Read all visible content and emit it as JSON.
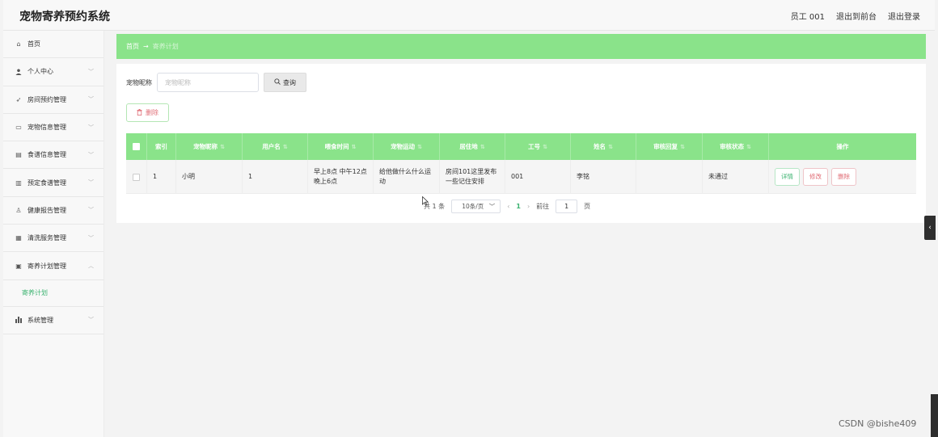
{
  "app": {
    "title": "宠物寄养预约系统"
  },
  "header": {
    "user": "员工 001",
    "to_front": "退出到前台",
    "logout": "退出登录"
  },
  "sidebar": {
    "items": [
      {
        "label": "首页",
        "icon": "home-icon",
        "glyph": "⌂",
        "has_children": false
      },
      {
        "label": "个人中心",
        "icon": "user-icon",
        "glyph": "👤",
        "has_children": true
      },
      {
        "label": "房间预约管理",
        "icon": "send-icon",
        "glyph": "➶",
        "has_children": true
      },
      {
        "label": "宠物信息管理",
        "icon": "message-icon",
        "glyph": "▭",
        "has_children": true
      },
      {
        "label": "食谱信息管理",
        "icon": "document-icon",
        "glyph": "▤",
        "has_children": true
      },
      {
        "label": "预定食谱管理",
        "icon": "box-icon",
        "glyph": "▥",
        "has_children": true
      },
      {
        "label": "健康报告管理",
        "icon": "bell-icon",
        "glyph": "♙",
        "has_children": true
      },
      {
        "label": "清洗服务管理",
        "icon": "wallet-icon",
        "glyph": "▦",
        "has_children": true
      },
      {
        "label": "寄养计划管理",
        "icon": "printer-icon",
        "glyph": "▣",
        "has_children": true,
        "expanded": true
      },
      {
        "label": "系统管理",
        "icon": "chart-icon",
        "glyph": "▥",
        "has_children": true
      }
    ],
    "sub_item": "寄养计划"
  },
  "breadcrumb": {
    "home": "首页",
    "arrow": "→",
    "current": "寄养计划"
  },
  "search": {
    "label": "宠物昵称",
    "placeholder": "宠物昵称",
    "button": "查询"
  },
  "actions": {
    "delete": "删除"
  },
  "table": {
    "columns": [
      "索引",
      "宠物昵称",
      "用户名",
      "喂食时间",
      "宠物运动",
      "居住地",
      "工号",
      "姓名",
      "审核回复",
      "审核状态",
      "操作"
    ],
    "rows": [
      {
        "index": "1",
        "pet_name": "小明",
        "username": "1",
        "feeding_time": "早上8点 中午12点晚上6点",
        "pet_exercise": "给他做什么什么运动",
        "residence": "房间101这里发布一些记住安排",
        "staff_no": "001",
        "name": "李铭",
        "review_reply": "",
        "review_status": "未通过",
        "ops": {
          "detail": "详情",
          "edit": "修改",
          "delete": "删除"
        }
      }
    ]
  },
  "pagination": {
    "total": "共 1 条",
    "page_size": "10条/页",
    "current_page": "1",
    "goto_prefix": "前往",
    "goto_value": "1",
    "goto_suffix": "页"
  },
  "watermark": "CSDN @bishe409",
  "colors": {
    "accent": "#8ae38a",
    "active_text": "#3cb371",
    "danger": "#e06c75"
  }
}
